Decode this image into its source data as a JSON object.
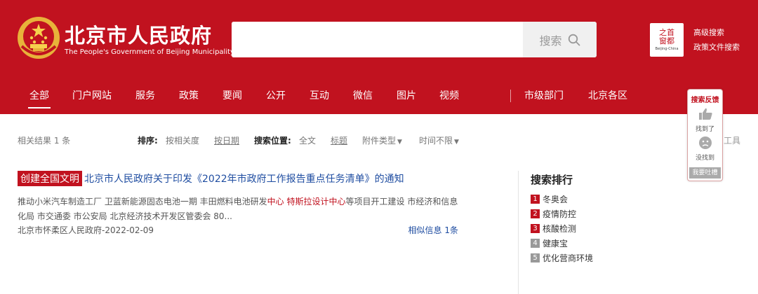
{
  "header": {
    "title": "北京市人民政府",
    "subtitle": "The People's Government of Beijing Municipality",
    "search": {
      "value": "",
      "placeholder": "",
      "button_label": "搜索"
    },
    "logo": {
      "chars_top": "之首",
      "chars_bottom": "窗都",
      "en": "Beijing-China"
    },
    "links": [
      "高级搜索",
      "政策文件搜索"
    ]
  },
  "nav": {
    "items": [
      "全部",
      "门户网站",
      "服务",
      "政策",
      "要闻",
      "公开",
      "互动",
      "微信",
      "图片",
      "视频",
      "市级部门",
      "北京各区"
    ],
    "active_index": 0
  },
  "toolbar": {
    "result_count": "相关结果 1 条",
    "sort_label": "排序:",
    "sort_relevance": "按相关度",
    "sort_date": "按日期",
    "position_label": "搜索位置:",
    "position_full": "全文",
    "position_title": "标题",
    "attachment_type": "附件类型",
    "time_range": "时间不限",
    "tools": "工具"
  },
  "results": [
    {
      "tag": "创建全国文明",
      "title": "北京市人民政府关于印发《2022年市政府工作报告重点任务清单》的通知",
      "snippet_a": "推动小米汽车制造工厂 卫蓝新能源固态电池一期 丰田燃料电池研发",
      "snippet_hl1": "中心",
      "snippet_b": " 特斯拉设计",
      "snippet_hl2": "中心",
      "snippet_c": "等项目开工建设 市经济和信息化局 市交通委 市公安局 北京经济技术开发区管委会 80...",
      "source_date": "北京市怀柔区人民政府-2022-02-09",
      "similar": "相似信息 1条"
    }
  ],
  "ranking": {
    "title": "搜索排行",
    "items": [
      {
        "rank": "1",
        "label": "冬奥会"
      },
      {
        "rank": "2",
        "label": "疫情防控"
      },
      {
        "rank": "3",
        "label": "核酸检测"
      },
      {
        "rank": "4",
        "label": "健康宝"
      },
      {
        "rank": "5",
        "label": "优化营商环境"
      }
    ]
  },
  "feedback": {
    "title": "搜索反馈",
    "found": "找到了",
    "not_found": "没找到",
    "complain": "我要吐槽"
  },
  "colors": {
    "brand_red": "#c1121f",
    "link_blue": "#1f4da1"
  }
}
